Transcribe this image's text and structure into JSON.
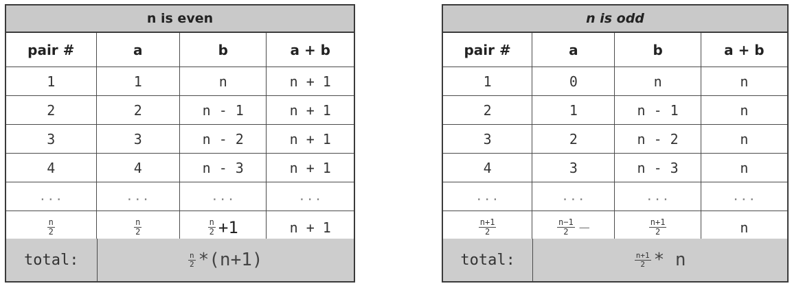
{
  "even": {
    "title": "n is even",
    "headers": [
      "pair #",
      "a",
      "b",
      "a + b"
    ],
    "rows": [
      [
        "1",
        "1",
        "n",
        "n + 1"
      ],
      [
        "2",
        "2",
        "n - 1",
        "n + 1"
      ],
      [
        "3",
        "3",
        "n - 2",
        "n + 1"
      ],
      [
        "4",
        "4",
        "n - 3",
        "n + 1"
      ],
      [
        "...",
        "...",
        "...",
        "..."
      ]
    ],
    "last_row": {
      "pair": {
        "num": "n",
        "den": "2"
      },
      "a": {
        "num": "n",
        "den": "2"
      },
      "b": {
        "num": "n",
        "den": "2",
        "suffix": "+1"
      },
      "sum": "n + 1"
    },
    "total": {
      "label": "total:",
      "frac": {
        "num": "n",
        "den": "2"
      },
      "rest": "*(n+1)"
    }
  },
  "odd": {
    "title": "n is odd",
    "headers": [
      "pair #",
      "a",
      "b",
      "a + b"
    ],
    "rows": [
      [
        "1",
        "0",
        "n",
        "n"
      ],
      [
        "2",
        "1",
        "n - 1",
        "n"
      ],
      [
        "3",
        "2",
        "n - 2",
        "n"
      ],
      [
        "4",
        "3",
        "n - 3",
        "n"
      ],
      [
        "...",
        "...",
        "...",
        "..."
      ]
    ],
    "last_row": {
      "pair": {
        "num": "n+1",
        "den": "2"
      },
      "a": {
        "num": "n−1",
        "den": "2",
        "suffix": "—"
      },
      "b": {
        "num": "n+1",
        "den": "2"
      },
      "sum": "n"
    },
    "total": {
      "label": "total:",
      "frac": {
        "num": "n+1",
        "den": "2"
      },
      "rest": "* n"
    }
  }
}
